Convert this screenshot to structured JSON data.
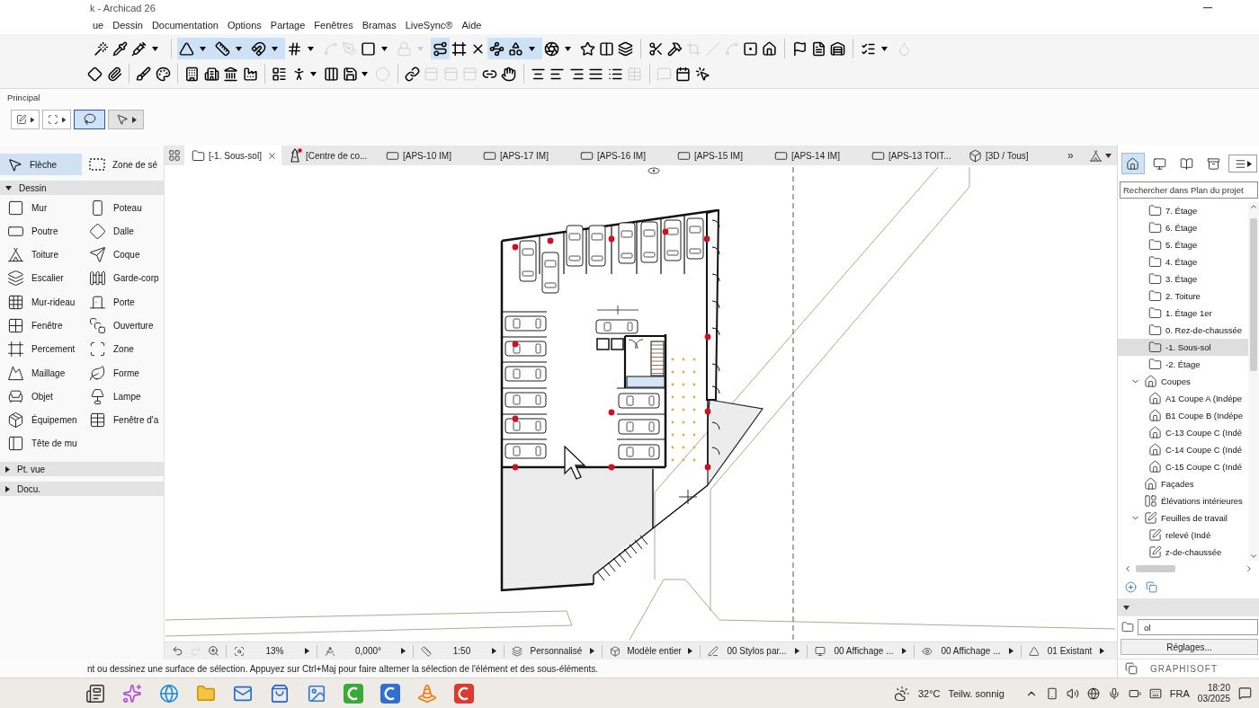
{
  "window": {
    "title": "k - Archicad 26"
  },
  "menu": [
    "ue",
    "Dessin",
    "Documentation",
    "Options",
    "Partage",
    "Fenêtres",
    "Bramas",
    "LiveSync®",
    "Aide"
  ],
  "toolbars": {
    "row_1": [
      [
        {
          "kind": "tool",
          "selected": false,
          "disabled": false
        },
        {
          "kind": "tool",
          "selected": false,
          "disabled": false
        },
        {
          "kind": "split",
          "selected": false,
          "disabled": false
        }
      ],
      [
        {
          "kind": "split",
          "selected": true,
          "disabled": false
        },
        {
          "kind": "split",
          "selected": true,
          "disabled": false
        },
        {
          "kind": "split",
          "selected": true,
          "disabled": false
        },
        {
          "kind": "split",
          "selected": false,
          "disabled": false
        },
        {
          "kind": "tool",
          "selected": false,
          "disabled": true
        },
        {
          "kind": "tool",
          "selected": false,
          "disabled": true
        },
        {
          "kind": "split",
          "selected": false,
          "disabled": false
        },
        {
          "kind": "split",
          "selected": false,
          "disabled": true
        },
        {
          "kind": "tool",
          "selected": true,
          "disabled": false
        },
        {
          "kind": "tool",
          "selected": false,
          "disabled": false
        },
        {
          "kind": "tool",
          "selected": false,
          "disabled": false
        },
        {
          "kind": "tool",
          "selected": true,
          "disabled": false
        },
        {
          "kind": "split",
          "selected": true,
          "disabled": false
        },
        {
          "kind": "split",
          "selected": false,
          "disabled": false
        },
        {
          "kind": "tool",
          "selected": false,
          "disabled": false
        },
        {
          "kind": "tool",
          "selected": false,
          "disabled": false
        },
        {
          "kind": "tool",
          "selected": false,
          "disabled": false
        }
      ],
      [
        {
          "kind": "tool",
          "selected": false,
          "disabled": false
        },
        {
          "kind": "tool",
          "selected": false,
          "disabled": false
        },
        {
          "kind": "tool",
          "selected": false,
          "disabled": true
        },
        {
          "kind": "tool",
          "selected": false,
          "disabled": true
        },
        {
          "kind": "tool",
          "selected": false,
          "disabled": true
        },
        {
          "kind": "tool",
          "selected": false,
          "disabled": false
        },
        {
          "kind": "tool",
          "selected": false,
          "disabled": false
        }
      ],
      [
        {
          "kind": "tool",
          "selected": false,
          "disabled": false
        },
        {
          "kind": "tool",
          "selected": false,
          "disabled": false
        },
        {
          "kind": "tool",
          "selected": false,
          "disabled": false
        }
      ],
      [
        {
          "kind": "split",
          "selected": false,
          "disabled": false
        },
        {
          "kind": "tool",
          "selected": false,
          "disabled": true
        }
      ]
    ],
    "row_2": [
      [
        {
          "kind": "tool",
          "selected": false,
          "disabled": false
        },
        {
          "kind": "tool",
          "selected": false,
          "disabled": false
        }
      ],
      [
        {
          "kind": "tool",
          "selected": false,
          "disabled": false
        },
        {
          "kind": "tool",
          "selected": false,
          "disabled": false
        }
      ],
      [
        {
          "kind": "tool",
          "selected": false,
          "disabled": false
        },
        {
          "kind": "tool",
          "selected": false,
          "disabled": false
        },
        {
          "kind": "tool",
          "selected": false,
          "disabled": false
        },
        {
          "kind": "tool",
          "selected": false,
          "disabled": false
        }
      ],
      [
        {
          "kind": "tool",
          "selected": false,
          "disabled": false
        },
        {
          "kind": "split",
          "selected": false,
          "disabled": false
        },
        {
          "kind": "tool",
          "selected": false,
          "disabled": false
        },
        {
          "kind": "split",
          "selected": false,
          "disabled": false
        },
        {
          "kind": "tool",
          "selected": false,
          "disabled": true
        }
      ],
      [
        {
          "kind": "tool",
          "selected": false,
          "disabled": false
        },
        {
          "kind": "tool",
          "selected": false,
          "disabled": true
        },
        {
          "kind": "tool",
          "selected": false,
          "disabled": true
        },
        {
          "kind": "tool",
          "selected": false,
          "disabled": true
        },
        {
          "kind": "tool",
          "selected": false,
          "disabled": false
        },
        {
          "kind": "tool",
          "selected": false,
          "disabled": false
        }
      ],
      [
        {
          "kind": "tool",
          "selected": false,
          "disabled": false
        },
        {
          "kind": "tool",
          "selected": false,
          "disabled": false
        },
        {
          "kind": "tool",
          "selected": false,
          "disabled": false
        },
        {
          "kind": "tool",
          "selected": false,
          "disabled": false
        },
        {
          "kind": "tool",
          "selected": false,
          "disabled": false
        },
        {
          "kind": "tool",
          "selected": false,
          "disabled": true
        }
      ],
      [
        {
          "kind": "tool",
          "selected": false,
          "disabled": true
        },
        {
          "kind": "tool",
          "selected": false,
          "disabled": false
        },
        {
          "kind": "tool",
          "selected": false,
          "disabled": false
        }
      ]
    ]
  },
  "toolbox": {
    "label": "Principal",
    "tools": [
      {
        "kind": "split",
        "selected": false
      },
      {
        "kind": "split",
        "selected": false
      },
      {
        "kind": "tool",
        "selected": true
      },
      {
        "kind": "menu",
        "selected": false
      }
    ]
  },
  "palette": {
    "top": [
      {
        "label": "Flèche",
        "selected": true
      },
      {
        "label": "Zone de sé",
        "selected": false
      }
    ],
    "sections": [
      {
        "label": "Dessin",
        "expanded": true,
        "tools": [
          "Mur",
          "Poteau",
          "Poutre",
          "Dalle",
          "Toiture",
          "Coque",
          "Escalier",
          "Garde-corp",
          "Mur-rideau",
          "Porte",
          "Fenêtre",
          "Ouverture",
          "Percement",
          "Zone",
          "Maillage",
          "Forme",
          "Objet",
          "Lampe",
          "Équipemen",
          "Fenêtre d'a",
          "Tête de mu"
        ]
      },
      {
        "label": "Pt. vue",
        "expanded": false
      },
      {
        "label": "Docu.",
        "expanded": false
      }
    ]
  },
  "view_tabs": {
    "tabs": [
      {
        "label": "[-1. Sous-sol]",
        "kind": "plan",
        "selected": true
      },
      {
        "label": "[Centre de co...",
        "kind": "detail",
        "selected": false
      },
      {
        "label": "[APS-10 IM]",
        "kind": "layout",
        "selected": false
      },
      {
        "label": "[APS-17 IM]",
        "kind": "layout",
        "selected": false
      },
      {
        "label": "[APS-16 IM]",
        "kind": "layout",
        "selected": false
      },
      {
        "label": "[APS-15 IM]",
        "kind": "layout",
        "selected": false
      },
      {
        "label": "[APS-14 IM]",
        "kind": "layout",
        "selected": false
      },
      {
        "label": "[APS-13 TOIT...",
        "kind": "layout",
        "selected": false
      },
      {
        "label": "[3D / Tous]",
        "kind": "model",
        "selected": false
      }
    ],
    "overflow": "»"
  },
  "view_toolbar": {
    "navigation": [
      {
        "disabled": false
      },
      {
        "disabled": true
      },
      {
        "disabled": false
      }
    ],
    "fields": [
      "13%",
      "0,000°",
      "1:50",
      "Personnalisé",
      "Modèle entier",
      "00 Stylos par...",
      "00 Affichage ...",
      "00 Affichage ...",
      "01 Existant"
    ]
  },
  "status_bar": {
    "message": "nt ou dessinez une surface de sélection. Appuyez sur Ctrl+Maj pour faire alterner la sélection de l'élément et des sous-éléments."
  },
  "navigator": {
    "modes": [
      {
        "selected": true
      },
      {
        "selected": false
      },
      {
        "selected": false
      },
      {
        "selected": false
      }
    ],
    "search": {
      "placeholder": "Rechercher dans Plan du projet"
    },
    "stories": [
      {
        "label": "7. Étage",
        "selected": false
      },
      {
        "label": "6. Étage",
        "selected": false
      },
      {
        "label": "5. Étage",
        "selected": false
      },
      {
        "label": "4. Étage",
        "selected": false
      },
      {
        "label": "3. Étage",
        "selected": false
      },
      {
        "label": "2. Toiture",
        "selected": false
      },
      {
        "label": "1. Étage 1er",
        "selected": false
      },
      {
        "label": "0. Rez-de-chaussée",
        "selected": false
      },
      {
        "label": "-1. Sous-sol",
        "selected": true
      },
      {
        "label": "-2. Étage",
        "selected": false
      }
    ],
    "tree": [
      {
        "label": "Coupes",
        "kind": "section",
        "selected": false,
        "expanded": true,
        "children": [
          {
            "label": "A1 Coupe A (Indépe",
            "kind": "section",
            "selected": false
          },
          {
            "label": "B1 Coupe B (Indépe",
            "kind": "section",
            "selected": false
          },
          {
            "label": "C-13 Coupe C (Indé",
            "kind": "section",
            "selected": false
          },
          {
            "label": "C-14 Coupe C (Indé",
            "kind": "section",
            "selected": false
          },
          {
            "label": "C-15 Coupe C (Indé",
            "kind": "section",
            "selected": false
          }
        ]
      },
      {
        "label": "Façades",
        "kind": "elevation",
        "selected": false
      },
      {
        "label": "Élévations intérieures",
        "kind": "interior",
        "selected": false
      },
      {
        "label": "Feuilles de travail",
        "kind": "worksheet",
        "selected": false,
        "expanded": true,
        "children": [
          {
            "label": "relevé (Indé",
            "kind": "worksheet",
            "selected": false
          },
          {
            "label": "z-de-chaussée",
            "kind": "worksheet",
            "selected": false
          }
        ]
      }
    ],
    "properties": {
      "expanded": true,
      "value": "ol",
      "button": "Réglages..."
    },
    "footer": "GRAPHISOFT"
  },
  "taskbar": {
    "weather": {
      "temperature": "32°C",
      "condition": "Teilw. sonnig"
    },
    "language": "FRA",
    "time": "18:20",
    "date": "03/2025"
  }
}
